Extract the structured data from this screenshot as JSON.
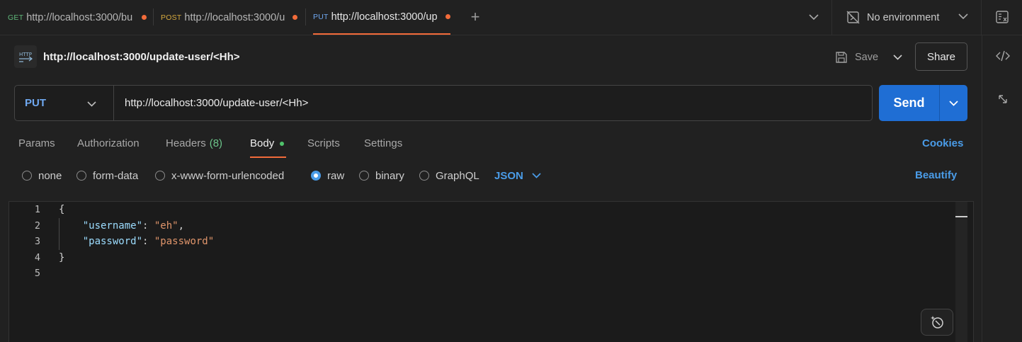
{
  "tabs": [
    {
      "method": "GET",
      "url": "http://localhost:3000/bu",
      "method_color": "#5fb87a",
      "unsaved": true
    },
    {
      "method": "POST",
      "url": "http://localhost:3000/u",
      "method_color": "#d6a93e",
      "unsaved": true
    },
    {
      "method": "PUT",
      "url": "http://localhost:3000/up",
      "method_color": "#6fa8f0",
      "unsaved": true,
      "active": true
    }
  ],
  "environment": {
    "label": "No environment"
  },
  "request": {
    "title": "http://localhost:3000/update-user/<Hh>",
    "save_label": "Save",
    "share_label": "Share",
    "method": "PUT",
    "url": "http://localhost:3000/update-user/<Hh>",
    "send_label": "Send"
  },
  "subtabs": {
    "params": "Params",
    "authorization": "Authorization",
    "headers": "Headers",
    "headers_count": "(8)",
    "body": "Body",
    "scripts": "Scripts",
    "settings": "Settings",
    "cookies": "Cookies"
  },
  "body_types": {
    "none": "none",
    "form_data": "form-data",
    "urlencoded": "x-www-form-urlencoded",
    "raw": "raw",
    "binary": "binary",
    "graphql": "GraphQL",
    "selected": "raw",
    "format": "JSON",
    "beautify": "Beautify"
  },
  "editor": {
    "line_numbers": [
      "1",
      "2",
      "3",
      "4",
      "5"
    ],
    "lines": {
      "open": "{",
      "key1": "\"username\"",
      "val1": "\"eh\"",
      "key2": "\"password\"",
      "val2": "\"password\"",
      "close": "}"
    }
  },
  "colors": {
    "accent": "#f26b3a",
    "primary": "#1f6ed4",
    "link": "#4a9ce8",
    "background": "#212121"
  }
}
